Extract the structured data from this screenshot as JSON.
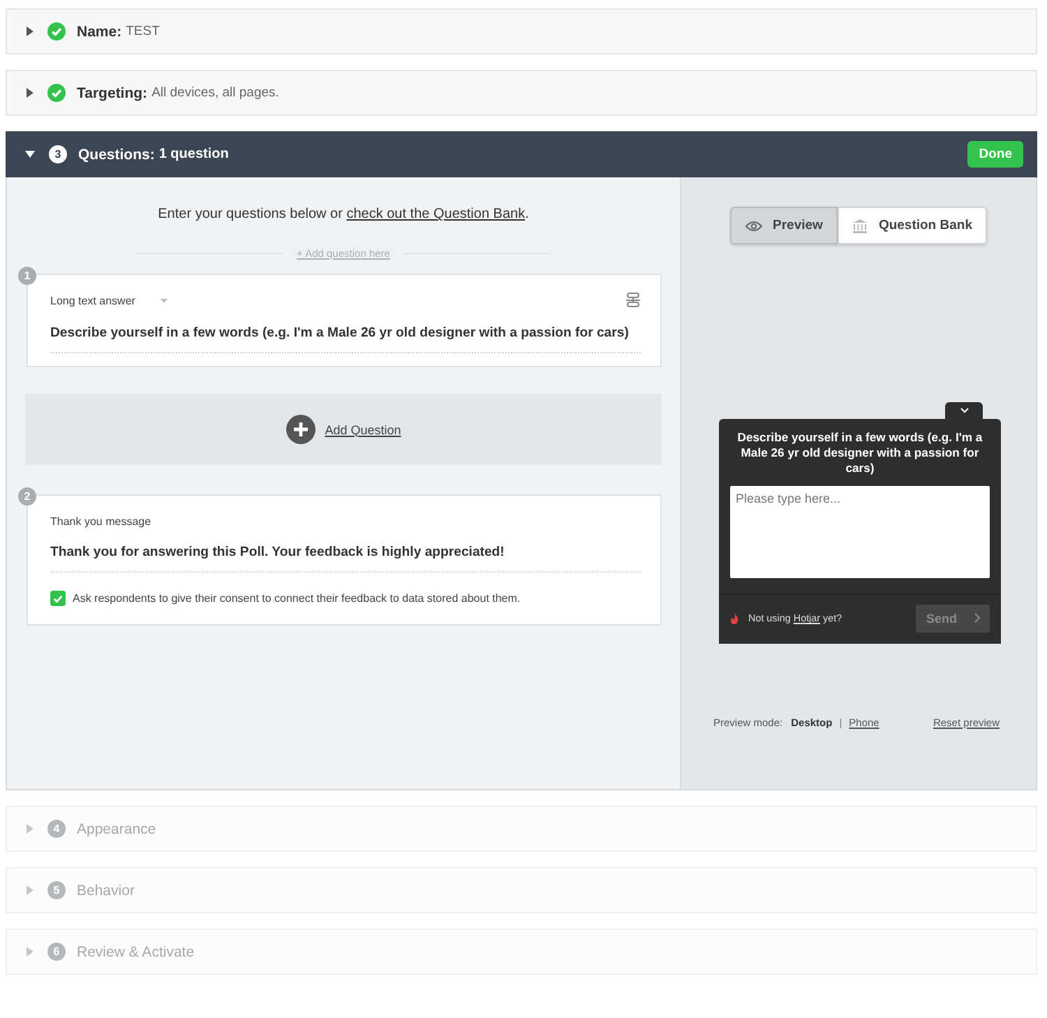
{
  "sections": [
    {
      "kind": "done",
      "expanded": false,
      "title": "Name:",
      "summary": "TEST"
    },
    {
      "kind": "done",
      "expanded": false,
      "title": "Targeting:",
      "summary": "All devices, all pages."
    },
    {
      "kind": "current",
      "expanded": true,
      "number": "3",
      "title": "Questions:",
      "summary": "1 question",
      "action": "Done"
    },
    {
      "kind": "pending",
      "expanded": false,
      "number": "4",
      "title": "Appearance"
    },
    {
      "kind": "pending",
      "expanded": false,
      "number": "5",
      "title": "Behavior"
    },
    {
      "kind": "pending",
      "expanded": false,
      "number": "6",
      "title": "Review & Activate"
    }
  ],
  "editor": {
    "intro": "Enter your questions below or ",
    "intro_link": "check out the Question Bank",
    "intro_end": ".",
    "add_here": "+ Add question here",
    "questions": [
      {
        "kind": "question",
        "number": "1",
        "type_label": "Long text answer",
        "text": "Describe yourself in a few words (e.g. I'm a Male 26 yr old designer with a passion for cars)"
      },
      {
        "kind": "thank_you",
        "number": "2",
        "type_label": "Thank you message",
        "text": "Thank you for answering this Poll. Your feedback is highly appreciated!",
        "consent": {
          "checked": true,
          "label": "Ask respondents to give their consent to connect their feedback to data stored about them."
        }
      }
    ],
    "add_question": "Add Question"
  },
  "preview": {
    "toggle": [
      {
        "label": "Preview",
        "selected": true
      },
      {
        "label": "Question Bank",
        "selected": false
      }
    ],
    "widget": {
      "question": "Describe yourself in a few words (e.g. I'm a Male 26 yr old designer with a passion for cars)",
      "placeholder": "Please type here...",
      "footer_prefix": "Not using ",
      "footer_link": "Hotjar",
      "footer_suffix": " yet?",
      "send": "Send",
      "send_disabled": true
    },
    "mode_label": "Preview mode:",
    "modes": [
      {
        "label": "Desktop",
        "selected": true
      },
      {
        "label": "Phone",
        "selected": false
      }
    ],
    "separator": "|",
    "reset": "Reset preview"
  }
}
